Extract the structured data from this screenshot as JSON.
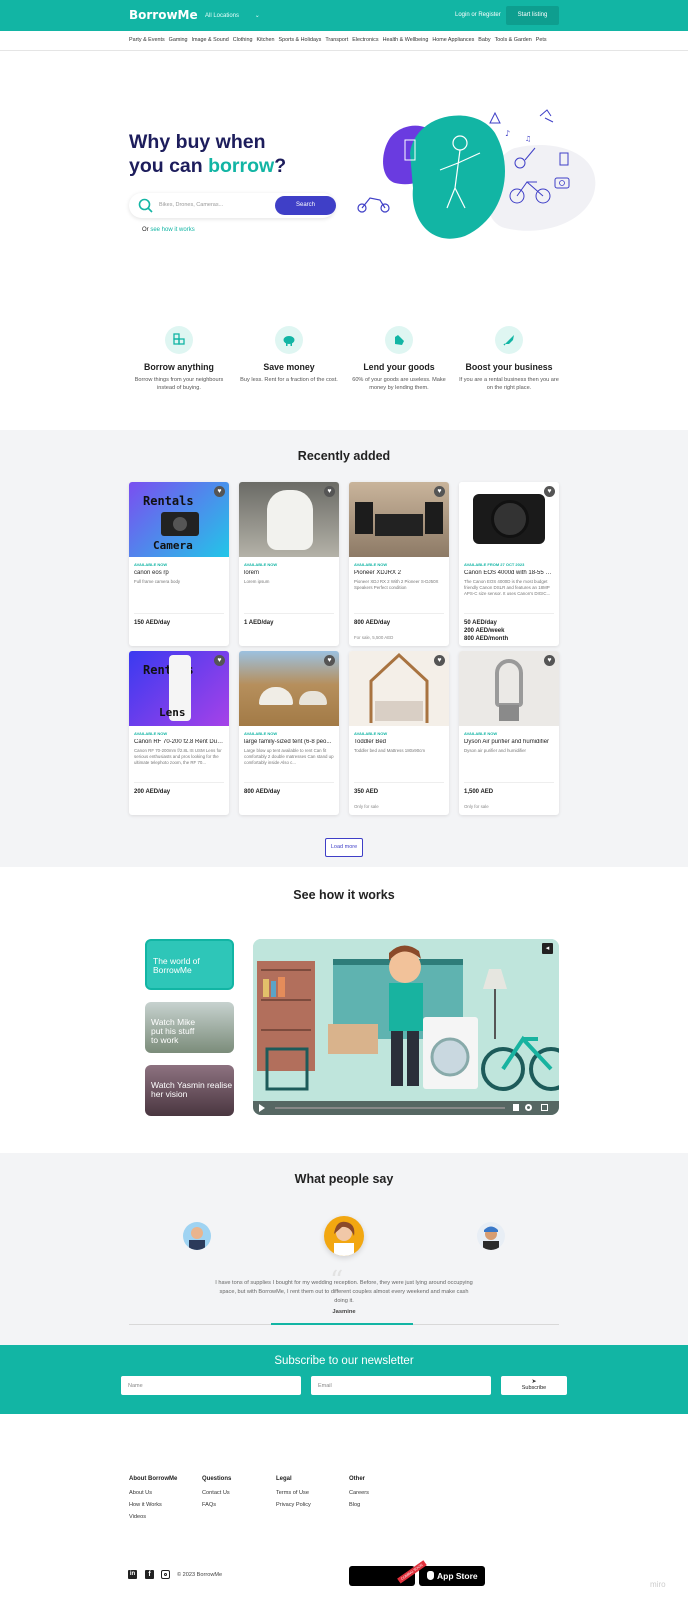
{
  "header": {
    "logo": "BorrowMe",
    "location": "All Locations",
    "login": "Login or Register",
    "start_listing": "Start listing"
  },
  "categories": [
    "Party & Events",
    "Gaming",
    "Image & Sound",
    "Clothing",
    "Kitchen",
    "Sports & Holidays",
    "Transport",
    "Electronics",
    "Health & Wellbeing",
    "Home Appliances",
    "Baby",
    "Tools & Garden",
    "Pets"
  ],
  "hero": {
    "title_line1": "Why buy when",
    "title_line2_pre": "you can ",
    "title_accent": "borrow",
    "title_end": "?",
    "search_placeholder": "Bikes, Drones, Cameras...",
    "search_button": "Search",
    "or_text": "Or ",
    "how_link": "see how it works"
  },
  "features": [
    {
      "title": "Borrow anything",
      "desc": "Borrow things from your neighbours instead of buying."
    },
    {
      "title": "Save money",
      "desc": "Buy less. Rent for a fraction of the cost."
    },
    {
      "title": "Lend your goods",
      "desc": "60% of your goods are useless. Make money by lending them."
    },
    {
      "title": "Boost your business",
      "desc": "If you are a rental business then you are on the right place."
    }
  ],
  "recent": {
    "heading": "Recently added",
    "load_more": "Load more",
    "items": [
      {
        "avail": "AVAILABLE NOW",
        "name": "canon eos rp",
        "desc": "Full frame camera body",
        "price": "150 AED/day",
        "price2": "",
        "price3": "",
        "sub": "",
        "img_text1": "Rentals",
        "img_text2": "Camera"
      },
      {
        "avail": "AVAILABLE NOW",
        "name": "lorem",
        "desc": "Lorem ipsum",
        "price": "1 AED/day",
        "price2": "",
        "price3": "",
        "sub": "",
        "img_text1": "",
        "img_text2": ""
      },
      {
        "avail": "AVAILABLE NOW",
        "name": "Pioneer XDJRX 2",
        "desc": "Pioneer XDJ RX 2 With 2 Pioneer S-DJ50X Speakers Perfect condition",
        "price": "800 AED/day",
        "price2": "",
        "price3": "",
        "sub": "For sale, 5,500 AED",
        "img_text1": "",
        "img_text2": ""
      },
      {
        "avail": "AVAILABLE FROM 27 OCT 2023",
        "name": "Canon EOS 4000d with 18-55 m...",
        "desc": "The Canon EOS 4000D is the most budget friendly Canon DSLR and features an 18MP APS-C size sensor. It uses Canon's DIGIC...",
        "price": "50 AED/day",
        "price2": "200 AED/week",
        "price3": "800 AED/month",
        "sub": "",
        "img_text1": "",
        "img_text2": ""
      },
      {
        "avail": "AVAILABLE NOW",
        "name": "Canon RF 70-200 f2.8 Rent Dubai",
        "desc": "Canon RF 70-200mm f/2.8L IS USM Lens for serious enthusiasts and pros looking for the ultimate telephoto zoom, the RF 70...",
        "price": "200 AED/day",
        "price2": "",
        "price3": "",
        "sub": "",
        "img_text1": "Rentals",
        "img_text2": "Lens"
      },
      {
        "avail": "AVAILABLE NOW",
        "name": "large family-sized tent (6-8 peo...",
        "desc": "Large blow up tent available to rent Can fit comfortably 2 double matresses Can stand up comfortably inside Also c...",
        "price": "800 AED/day",
        "price2": "",
        "price3": "",
        "sub": "",
        "img_text1": "",
        "img_text2": ""
      },
      {
        "avail": "AVAILABLE NOW",
        "name": "Toddler Bed",
        "desc": "Toddler bed and Mattress 180x90cm",
        "price": "350 AED",
        "price2": "",
        "price3": "",
        "sub": "Only for sale",
        "img_text1": "",
        "img_text2": ""
      },
      {
        "avail": "AVAILABLE NOW",
        "name": "Dyson Air purifier and humidifier",
        "desc": "Dyson air purifier and humidifier",
        "price": "1,500 AED",
        "price2": "",
        "price3": "",
        "sub": "Only for sale",
        "img_text1": "",
        "img_text2": ""
      }
    ]
  },
  "how": {
    "heading": "See how it works",
    "videos": [
      {
        "title": "The world of BorrowMe"
      },
      {
        "title": "Watch Mike put his stuff to work"
      },
      {
        "title": "Watch Yasmin realise her vision"
      }
    ]
  },
  "testimonials": {
    "heading": "What people say",
    "quote": "I have tons of supplies I bought for my wedding reception. Before, they were just lying around occupying space, but with BorrowMe, I rent them out to different couples almost every weekend and make cash doing it.",
    "name": "Jasmine"
  },
  "newsletter": {
    "heading": "Subscribe to our newsletter",
    "name_placeholder": "Name",
    "email_placeholder": "Email",
    "subscribe": "Subscribe"
  },
  "footer": {
    "columns": [
      {
        "heading": "About BorrowMe",
        "links": [
          "About Us",
          "How it Works",
          "Videos"
        ]
      },
      {
        "heading": "Questions",
        "links": [
          "Contact Us",
          "FAQs"
        ]
      },
      {
        "heading": "Legal",
        "links": [
          "Terms of Use",
          "Privacy Policy"
        ]
      },
      {
        "heading": "Other",
        "links": [
          "Careers",
          "Blog"
        ]
      }
    ],
    "copyright": "© 2023 BorrowMe",
    "app_store": "App Store",
    "coming_soon": "COMING SOON"
  },
  "watermark": "miro",
  "colors": {
    "brand": "#12b5a4",
    "accent": "#3f3fc7",
    "navy": "#1d1d5c"
  }
}
